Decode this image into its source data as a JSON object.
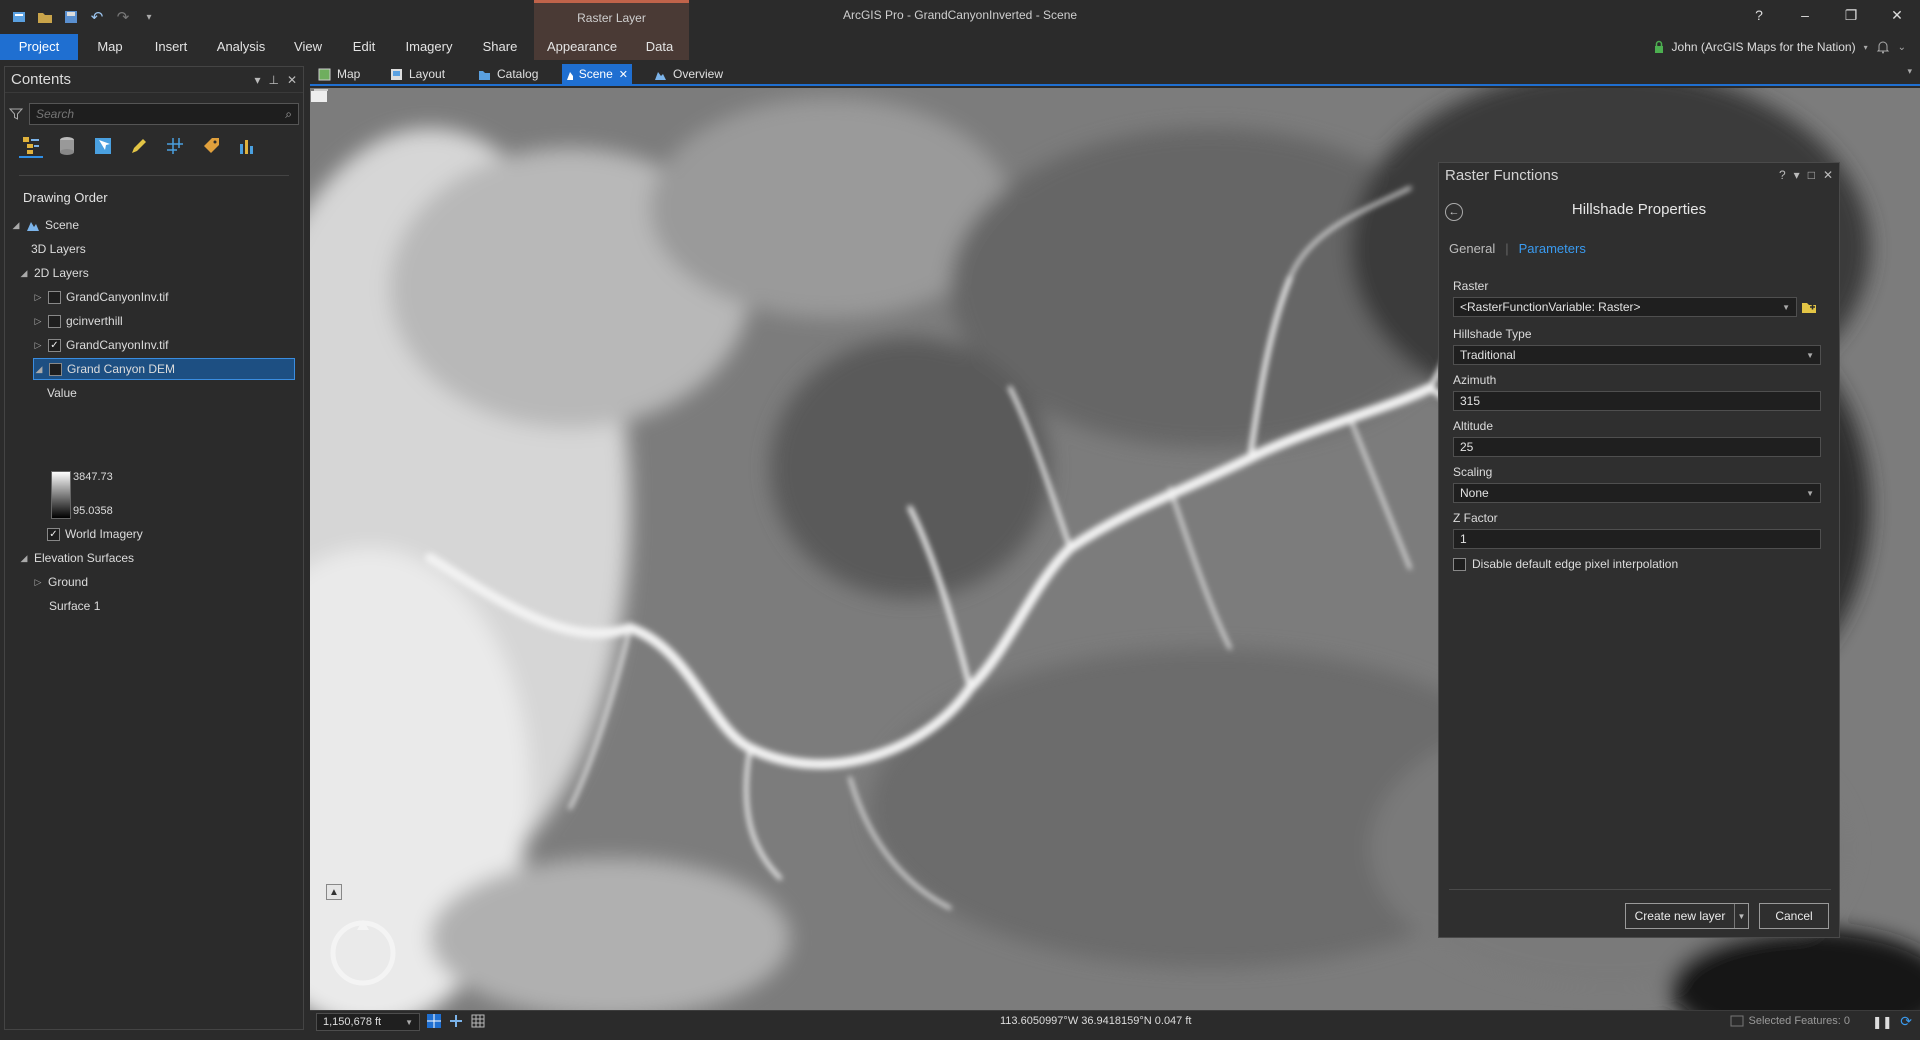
{
  "app": {
    "title": "ArcGIS Pro - GrandCanyonInverted - Scene",
    "context_tab_header": "Raster Layer"
  },
  "window_controls": {
    "help": "?",
    "minimize": "–",
    "restore": "❐",
    "close": "✕"
  },
  "ribbon": {
    "tabs": [
      "Project",
      "Map",
      "Insert",
      "Analysis",
      "View",
      "Edit",
      "Imagery",
      "Share",
      "Appearance",
      "Data"
    ],
    "active_tab": "Project",
    "user": "John (ArcGIS Maps for the Nation)"
  },
  "contents": {
    "title": "Contents",
    "search_placeholder": "Search",
    "drawing_order_label": "Drawing Order",
    "tree": {
      "scene": "Scene",
      "layers_3d": "3D Layers",
      "layers_2d": "2D Layers",
      "layer1": "GrandCanyonInv.tif",
      "layer2": "gcinverthill",
      "layer3": "GrandCanyonInv.tif",
      "layer4": "Grand Canyon DEM",
      "legend_value": "Value",
      "legend_high": "3847.73",
      "legend_low": "95.0358",
      "world_imagery": "World Imagery",
      "elevation_surfaces": "Elevation Surfaces",
      "ground": "Ground",
      "surface1": "Surface 1"
    }
  },
  "view_tabs": [
    "Map",
    "Layout",
    "Catalog",
    "Scene",
    "Overview"
  ],
  "active_view_tab": "Scene",
  "raster_functions": {
    "title": "Raster Functions",
    "properties_title": "Hillshade Properties",
    "tab_general": "General",
    "tab_parameters": "Parameters",
    "raster_label": "Raster",
    "raster_value": "<RasterFunctionVariable: Raster>",
    "hillshade_type_label": "Hillshade Type",
    "hillshade_type_value": "Traditional",
    "azimuth_label": "Azimuth",
    "azimuth_value": "315",
    "altitude_label": "Altitude",
    "altitude_value": "25",
    "scaling_label": "Scaling",
    "scaling_value": "None",
    "zfactor_label": "Z Factor",
    "zfactor_value": "1",
    "edge_interp_label": "Disable default edge pixel interpolation",
    "create_button": "Create new layer",
    "cancel_button": "Cancel"
  },
  "status": {
    "scale": "1,150,678 ft",
    "coordinates": "113.6050997°W 36.9418159°N  0.047 ft",
    "selected_features": "Selected Features: 0"
  },
  "colors": {
    "accent": "#1f6fd1",
    "context_tab": "#4a3a35",
    "link": "#3a9bf0"
  }
}
